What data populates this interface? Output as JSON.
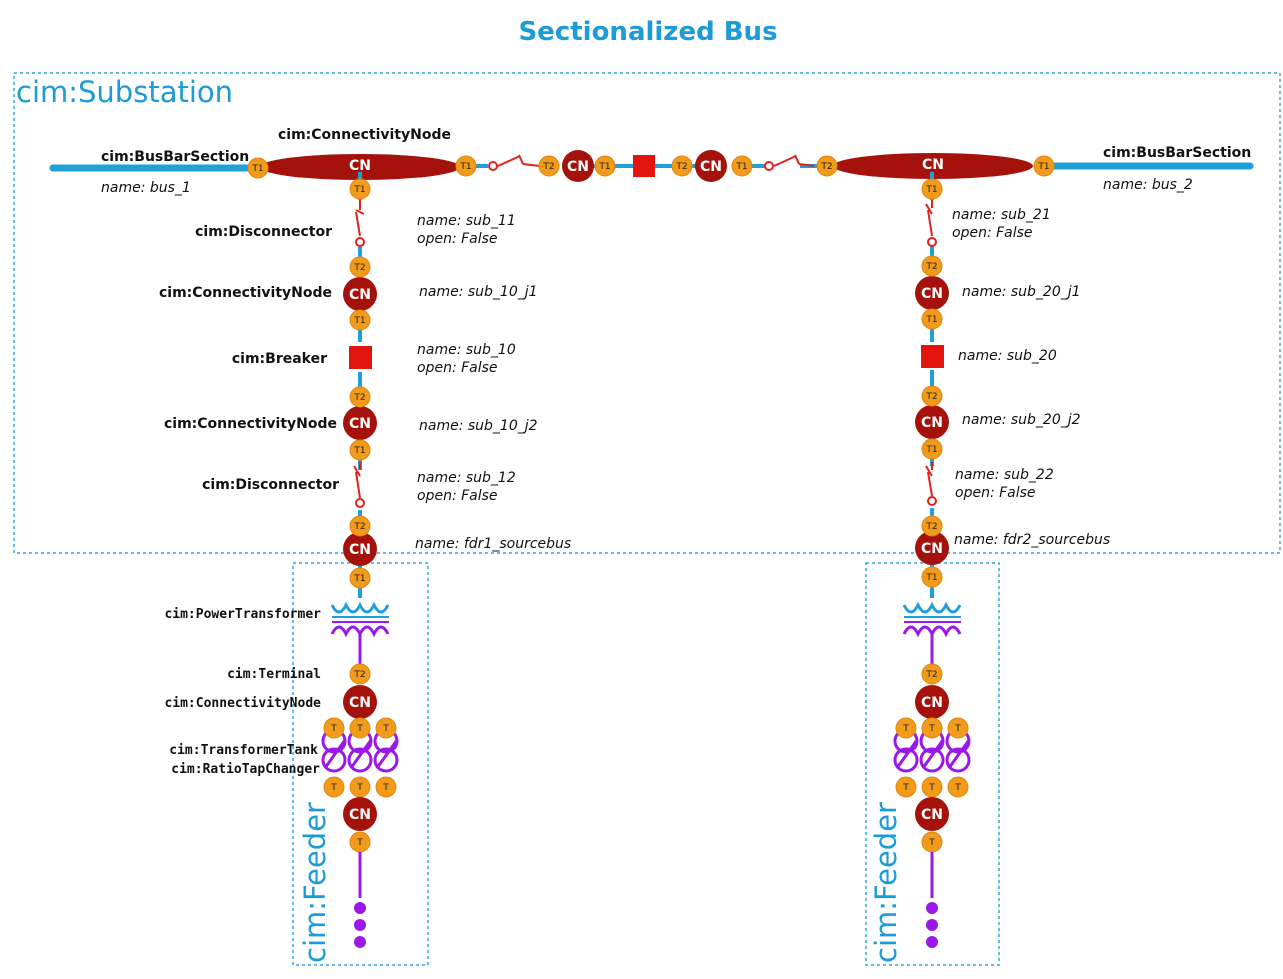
{
  "title": "Sectionalized Bus",
  "containers": {
    "substation": "cim:Substation",
    "feeder_left": "cim:Feeder",
    "feeder_right": "cim:Feeder"
  },
  "class_labels": {
    "busbar_left": "cim:BusBarSection",
    "busbar_right": "cim:BusBarSection",
    "cn_top": "cim:ConnectivityNode",
    "disconnector_1": "cim:Disconnector",
    "cn_1": "cim:ConnectivityNode",
    "breaker": "cim:Breaker",
    "cn_2": "cim:ConnectivityNode",
    "disconnector_2": "cim:Disconnector",
    "power_transformer": "cim:PowerTransformer",
    "terminal": "cim:Terminal",
    "cn_3": "cim:ConnectivityNode",
    "transformer_tank": "cim:TransformerTank",
    "ratio_tap_changer": "cim:RatioTapChanger"
  },
  "attributes": {
    "bus_1": "name: bus_1",
    "bus_2": "name: bus_2",
    "sub_11_name": "name: sub_11",
    "sub_11_open": "open: False",
    "sub_10_j1": "name: sub_10_j1",
    "sub_10_name": "name: sub_10",
    "sub_10_open": "open: False",
    "sub_10_j2": "name: sub_10_j2",
    "sub_12_name": "name: sub_12",
    "sub_12_open": "open: False",
    "fdr1": "name: fdr1_sourcebus",
    "sub_21_name": "name: sub_21",
    "sub_21_open": "open: False",
    "sub_20_j1": "name: sub_20_j1",
    "sub_20_name": "name: sub_20",
    "sub_20_j2": "name: sub_20_j2",
    "sub_22_name": "name: sub_22",
    "sub_22_open": "open: False",
    "fdr2": "name: fdr2_sourcebus"
  },
  "node_labels": {
    "cn": "CN",
    "t": "T",
    "t1": "T1",
    "t2": "T2"
  },
  "colors": {
    "title_blue": "#1b9bd7",
    "wire_blue": "#20a0d8",
    "node_red": "#a5120c",
    "terminal_orange": "#f29a19",
    "switch_red": "#e3211c",
    "winding_purple": "#9b19e8"
  }
}
